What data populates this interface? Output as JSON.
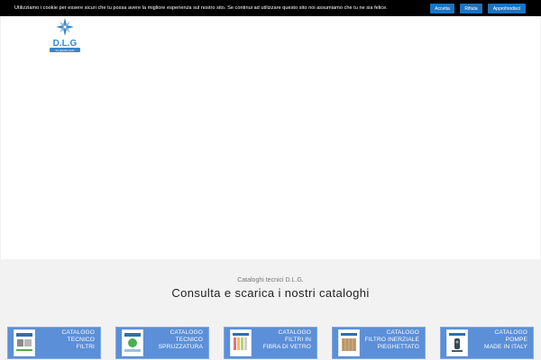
{
  "cookie_bar": {
    "text": "Utilizziamo i cookie per essere sicuri che tu possa avere la migliore esperienza sul nostro sito. Se continui ad utilizzare questo sito noi assumiamo che tu ne sia felice.",
    "accept_label": "Accetta",
    "refuse_label": "Rifiuta",
    "more_label": "Approfondisci"
  },
  "logo": {
    "text": "D.L.G",
    "tagline": "tra giardini ardo"
  },
  "catalogs": {
    "subtitle": "Cataloghi tecnici D.L.G.",
    "title": "Consulta e scarica i nostri cataloghi",
    "items": [
      {
        "line1": "CATALOGO",
        "line2": "TECNICO",
        "line3": "FILTRI"
      },
      {
        "line1": "CATALOGO",
        "line2": "TECNICO",
        "line3": "SPRUZZATURA"
      },
      {
        "line1": "CATALOGO",
        "line2": "FILTRI IN",
        "line3": "FIBRA DI VETRO"
      },
      {
        "line1": "CATALOGO",
        "line2": "FILTRO INERZIALE",
        "line3": "PIEGHETTATO"
      },
      {
        "line1": "CATALOGO",
        "line2": "POMPE",
        "line3": "MADE IN ITALY"
      }
    ]
  },
  "colors": {
    "accent": "#1e73be",
    "card": "#5b8fd8",
    "logo": "#3a86c8"
  }
}
